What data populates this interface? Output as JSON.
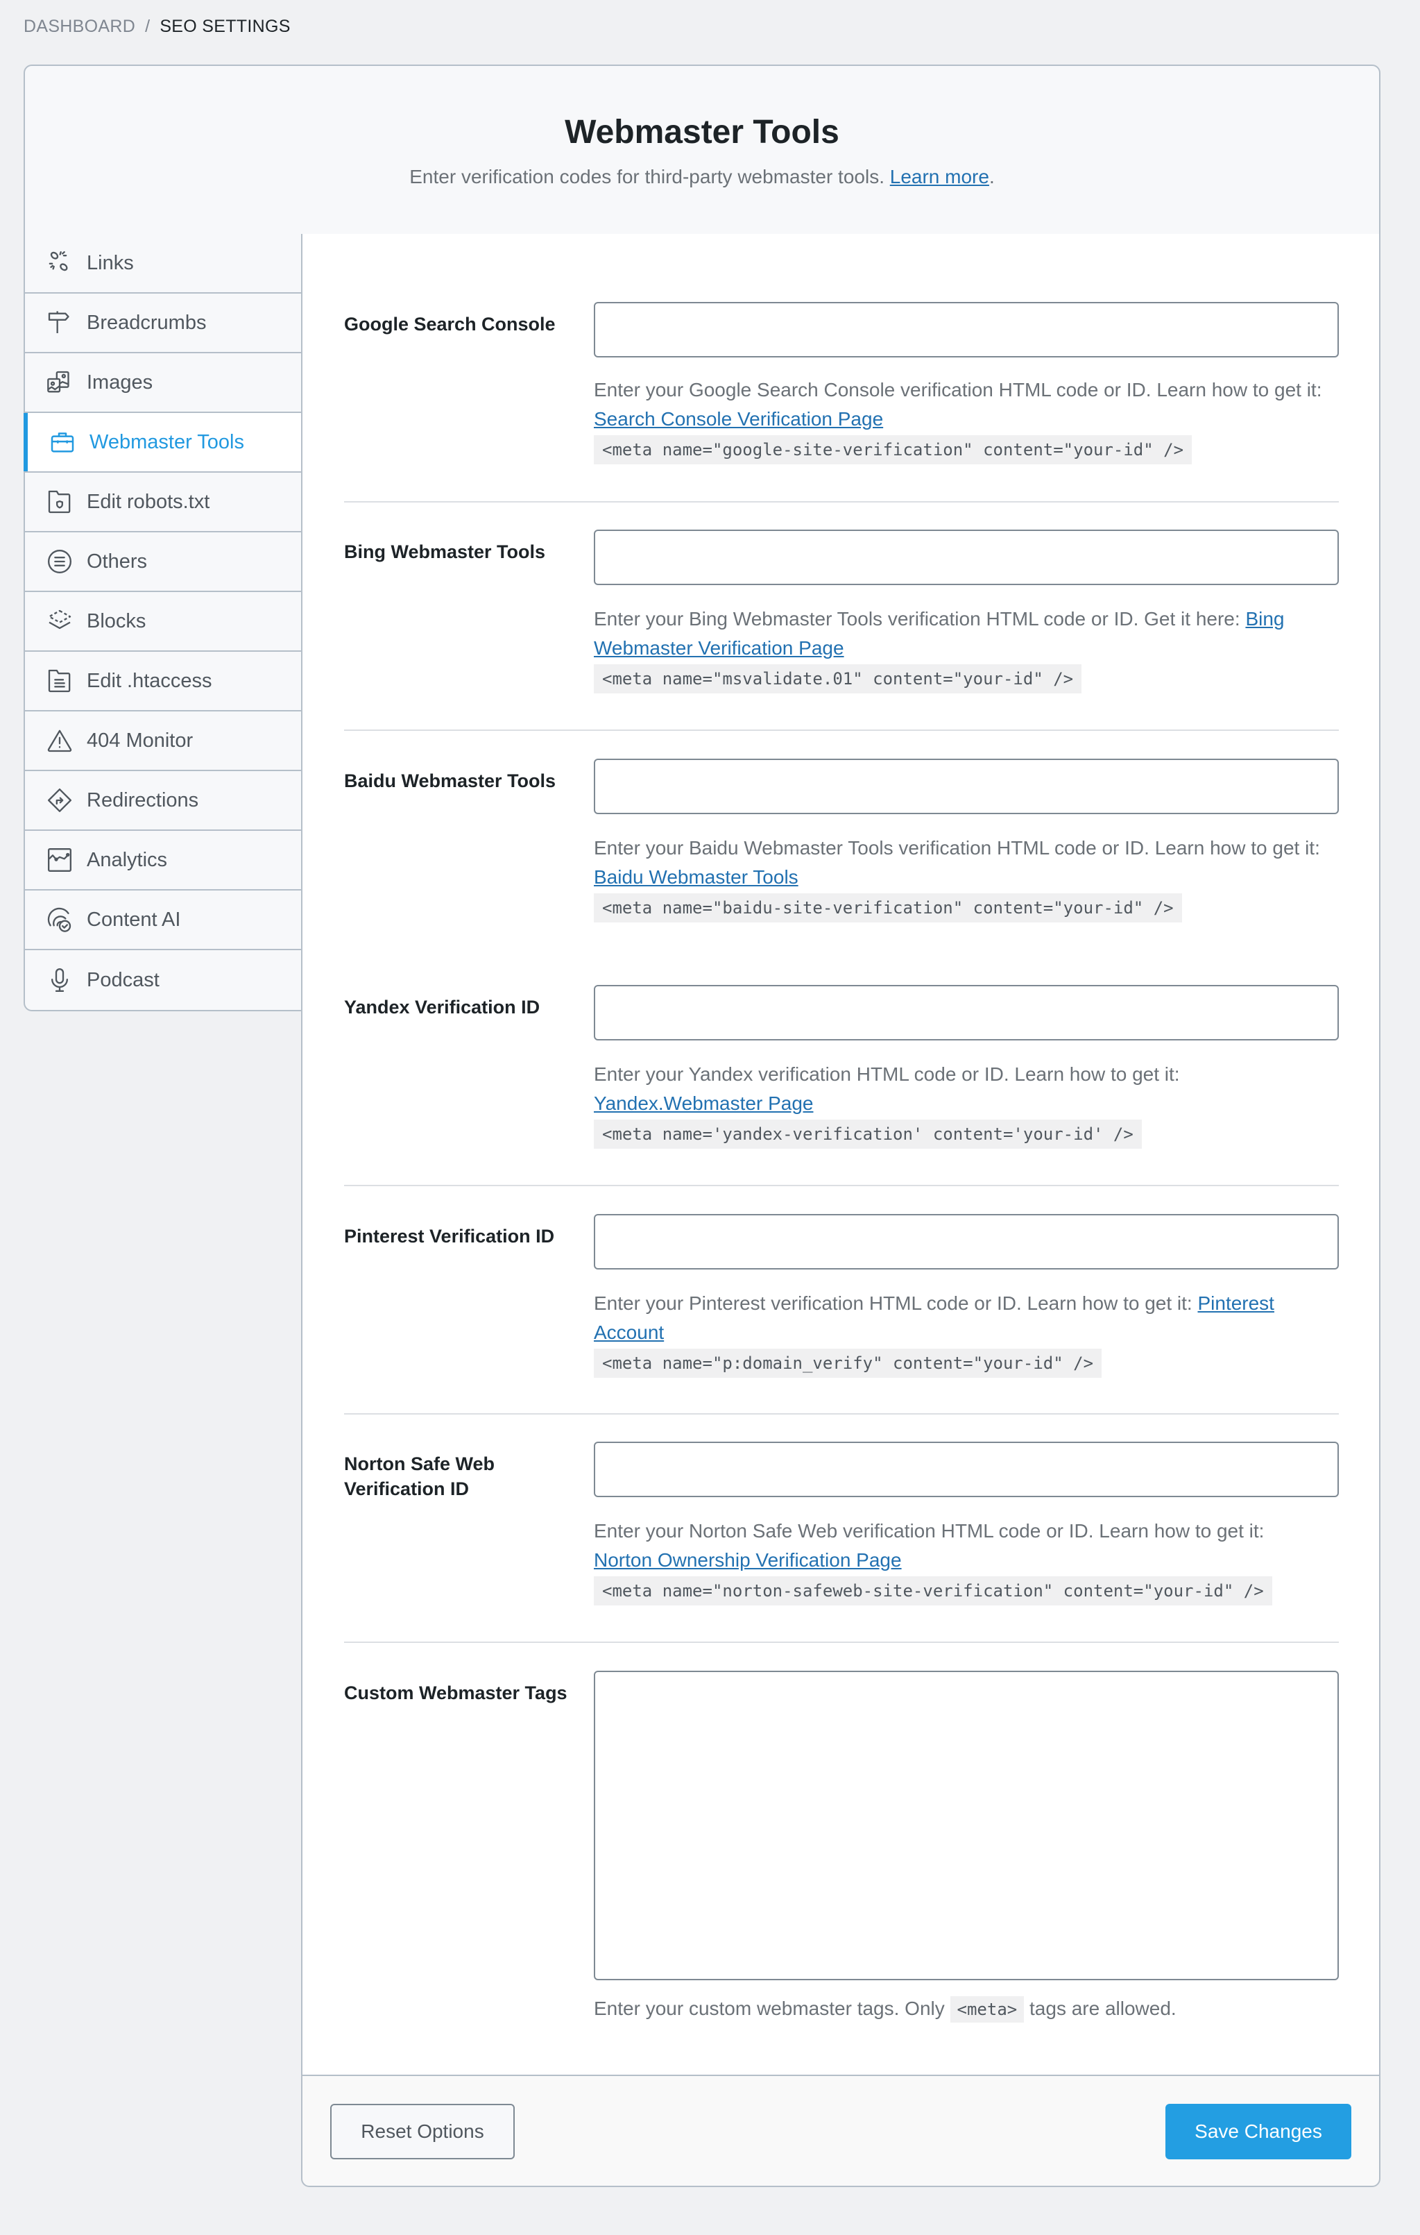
{
  "breadcrumb": {
    "root": "DASHBOARD",
    "separator": "/",
    "current": "SEO SETTINGS"
  },
  "header": {
    "title": "Webmaster Tools",
    "description": "Enter verification codes for third-party webmaster tools.",
    "learn_more": "Learn more",
    "learn_more_suffix": "."
  },
  "sidebar": {
    "active_color": "#2199e0",
    "items": [
      {
        "label": "Links",
        "icon": "link-broken-icon"
      },
      {
        "label": "Breadcrumbs",
        "icon": "signpost-icon"
      },
      {
        "label": "Images",
        "icon": "images-icon"
      },
      {
        "label": "Webmaster Tools",
        "icon": "toolbox-icon",
        "active": true
      },
      {
        "label": "Edit robots.txt",
        "icon": "folder-shield-icon"
      },
      {
        "label": "Others",
        "icon": "list-circle-icon"
      },
      {
        "label": "Blocks",
        "icon": "layers-icon"
      },
      {
        "label": "Edit .htaccess",
        "icon": "folder-document-icon"
      },
      {
        "label": "404 Monitor",
        "icon": "warning-triangle-icon"
      },
      {
        "label": "Redirections",
        "icon": "redirect-diamond-icon"
      },
      {
        "label": "Analytics",
        "icon": "analytics-chart-icon"
      },
      {
        "label": "Content AI",
        "icon": "content-ai-icon"
      },
      {
        "label": "Podcast",
        "icon": "microphone-icon"
      }
    ]
  },
  "fields": {
    "google": {
      "label": "Google Search Console",
      "value": "",
      "help_prefix": "Enter your Google Search Console verification HTML code or ID. Learn how to get it:",
      "link": "Search Console Verification Page",
      "code": "<meta name=\"google-site-verification\" content=\"your-id\" />"
    },
    "bing": {
      "label": "Bing Webmaster Tools",
      "value": "",
      "help_prefix": "Enter your Bing Webmaster Tools verification HTML code or ID. Get it here:",
      "link": "Bing Webmaster Verification Page",
      "code": "<meta name=\"msvalidate.01\" content=\"your-id\" />"
    },
    "baidu": {
      "label": "Baidu Webmaster Tools",
      "value": "",
      "help_prefix": "Enter your Baidu Webmaster Tools verification HTML code or ID. Learn how to get it:",
      "link": "Baidu Webmaster Tools",
      "code": "<meta name=\"baidu-site-verification\" content=\"your-id\" />"
    },
    "yandex": {
      "label": "Yandex Verification ID",
      "value": "",
      "help_prefix": "Enter your Yandex verification HTML code or ID. Learn how to get it:",
      "link": "Yandex.Webmaster Page",
      "code": "<meta name='yandex-verification' content='your-id' />"
    },
    "pinterest": {
      "label": "Pinterest Verification ID",
      "value": "",
      "help_prefix": "Enter your Pinterest verification HTML code or ID. Learn how to get it:",
      "link": "Pinterest Account",
      "code": "<meta name=\"p:domain_verify\" content=\"your-id\" />"
    },
    "norton": {
      "label": "Norton Safe Web Verification ID",
      "value": "",
      "help_prefix": "Enter your Norton Safe Web verification HTML code or ID. Learn how to get it:",
      "link": "Norton Ownership Verification Page",
      "code": "<meta name=\"norton-safeweb-site-verification\" content=\"your-id\" />"
    },
    "custom": {
      "label": "Custom Webmaster Tags",
      "value": "",
      "help_prefix": "Enter your custom webmaster tags. Only",
      "code": "<meta>",
      "help_suffix": "tags are allowed."
    }
  },
  "footer": {
    "reset_label": "Reset Options",
    "save_label": "Save Changes",
    "save_color": "#239ee2"
  }
}
